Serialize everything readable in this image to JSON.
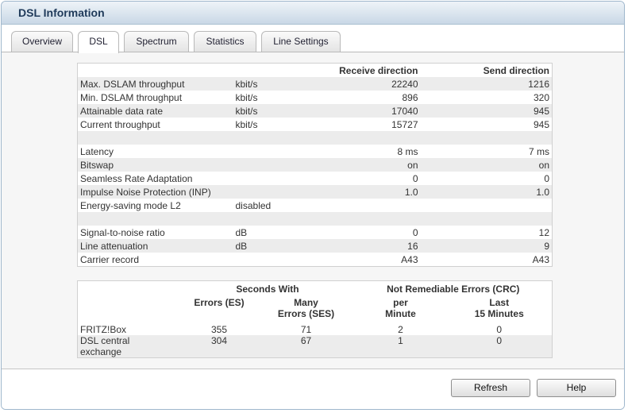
{
  "window": {
    "title": "DSL Information"
  },
  "tabs": [
    "Overview",
    "DSL",
    "Spectrum",
    "Statistics",
    "Line Settings"
  ],
  "active_tab": "DSL",
  "dsl_table": {
    "headers": {
      "receive": "Receive direction",
      "send": "Send direction"
    },
    "rows": [
      {
        "label": "Max. DSLAM throughput",
        "unit": "kbit/s",
        "receive": "22240",
        "send": "1216"
      },
      {
        "label": "Min. DSLAM throughput",
        "unit": "kbit/s",
        "receive": "896",
        "send": "320"
      },
      {
        "label": "Attainable data rate",
        "unit": "kbit/s",
        "receive": "17040",
        "send": "945"
      },
      {
        "label": "Current throughput",
        "unit": "kbit/s",
        "receive": "15727",
        "send": "945"
      },
      {
        "label": "",
        "unit": "",
        "receive": "",
        "send": ""
      },
      {
        "label": "Latency",
        "unit": "",
        "receive": "8 ms",
        "send": "7 ms"
      },
      {
        "label": "Bitswap",
        "unit": "",
        "receive": "on",
        "send": "on"
      },
      {
        "label": "Seamless Rate Adaptation",
        "unit": "",
        "receive": "0",
        "send": "0"
      },
      {
        "label": "Impulse Noise Protection (INP)",
        "unit": "",
        "receive": "1.0",
        "send": "1.0"
      },
      {
        "label": "Energy-saving mode L2",
        "unit": "disabled",
        "receive": "",
        "send": ""
      },
      {
        "label": "",
        "unit": "",
        "receive": "",
        "send": ""
      },
      {
        "label": "Signal-to-noise ratio",
        "unit": "dB",
        "receive": "0",
        "send": "12"
      },
      {
        "label": "Line attenuation",
        "unit": "dB",
        "receive": "16",
        "send": "9"
      },
      {
        "label": "Carrier record",
        "unit": "",
        "receive": "A43",
        "send": "A43"
      }
    ]
  },
  "error_table": {
    "group_headers": {
      "seconds_with": "Seconds With",
      "crc": "Not Remediable Errors (CRC)"
    },
    "col_headers": {
      "es": "Errors (ES)",
      "ses_1": "Many",
      "ses_2": "Errors (SES)",
      "per_1": "per",
      "per_2": "Minute",
      "last_1": "Last",
      "last_2": "15 Minutes"
    },
    "rows": [
      {
        "label_1": "FRITZ!Box",
        "label_2": "",
        "es": "355",
        "ses": "71",
        "per_minute": "2",
        "last_15": "0"
      },
      {
        "label_1": "DSL central",
        "label_2": "exchange",
        "es": "304",
        "ses": "67",
        "per_minute": "1",
        "last_15": "0"
      }
    ]
  },
  "buttons": {
    "refresh": "Refresh",
    "help": "Help"
  }
}
